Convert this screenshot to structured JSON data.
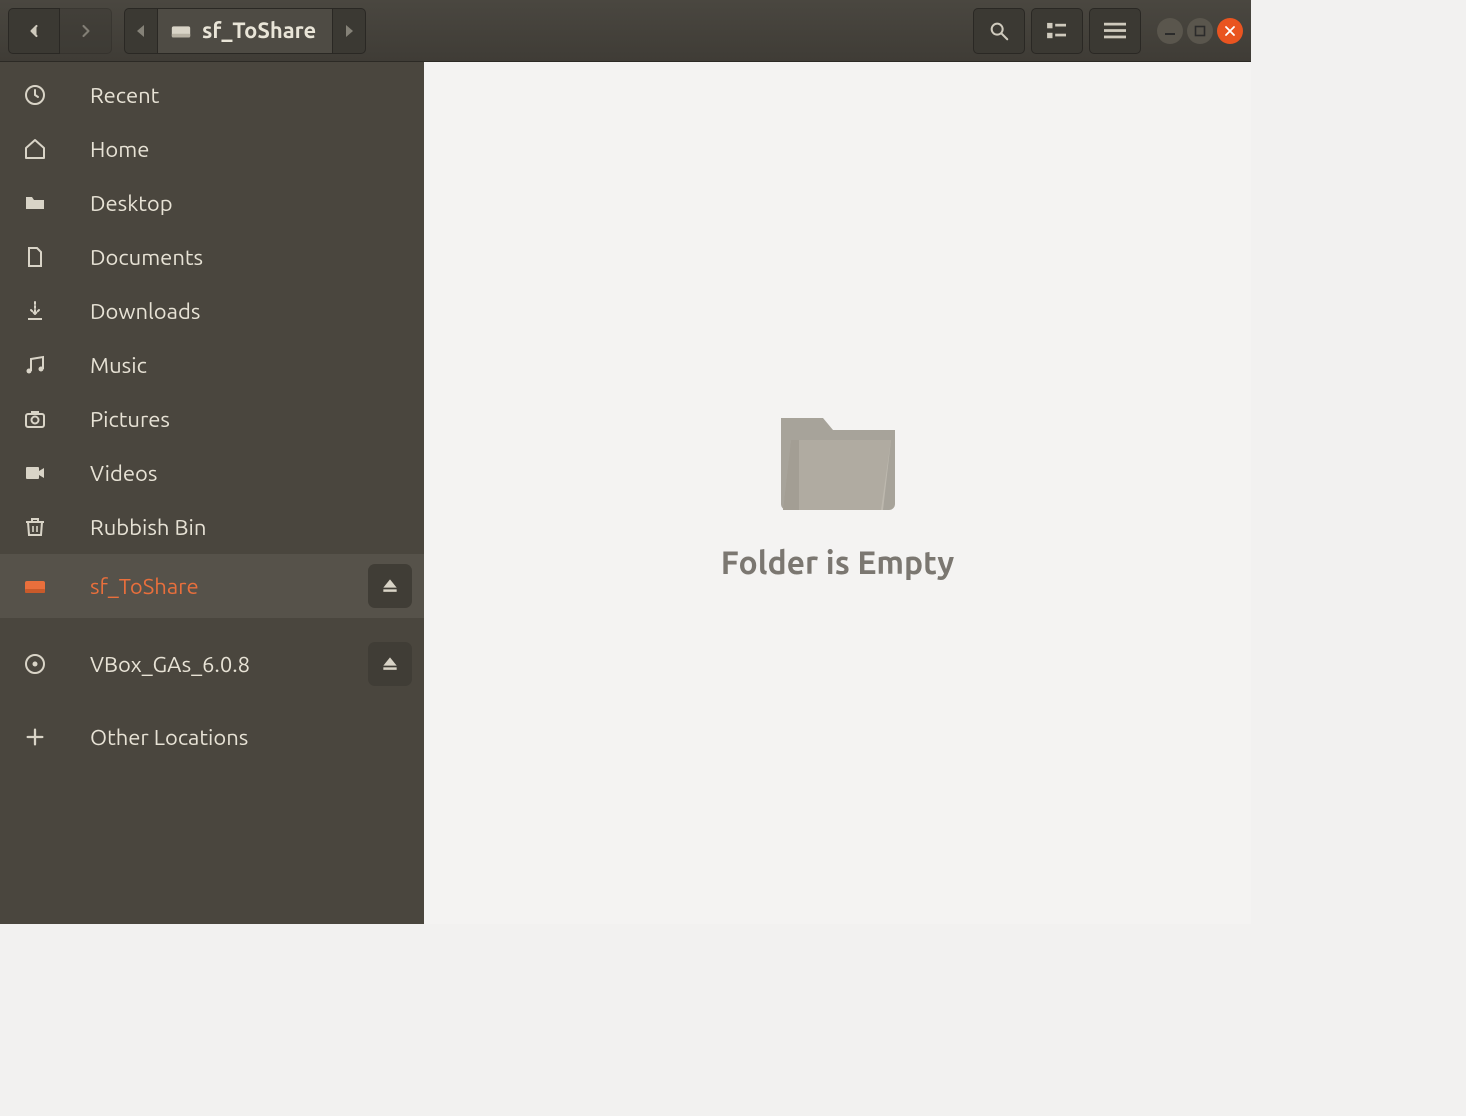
{
  "path": {
    "current": "sf_ToShare"
  },
  "sidebar": {
    "items": [
      {
        "label": "Recent"
      },
      {
        "label": "Home"
      },
      {
        "label": "Desktop"
      },
      {
        "label": "Documents"
      },
      {
        "label": "Downloads"
      },
      {
        "label": "Music"
      },
      {
        "label": "Pictures"
      },
      {
        "label": "Videos"
      },
      {
        "label": "Rubbish Bin"
      },
      {
        "label": "sf_ToShare"
      },
      {
        "label": "VBox_GAs_6.0.8"
      },
      {
        "label": "Other Locations"
      }
    ]
  },
  "content": {
    "empty_message": "Folder is Empty"
  }
}
